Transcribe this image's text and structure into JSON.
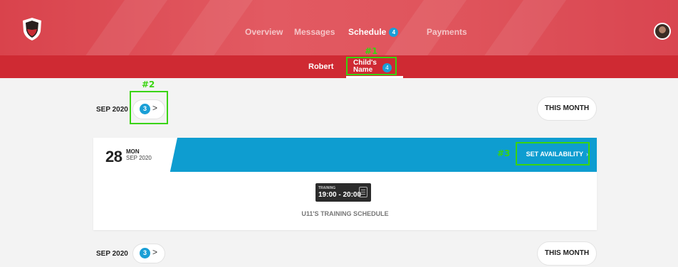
{
  "nav": {
    "items": [
      {
        "label": "Overview"
      },
      {
        "label": "Messages"
      },
      {
        "label": "Schedule",
        "badge": "4"
      },
      {
        "label": "Payments"
      }
    ]
  },
  "subnav": {
    "items": [
      {
        "label": "Robert"
      },
      {
        "label_line1": "Child's",
        "label_line2": "Name",
        "badge": "4"
      }
    ]
  },
  "annotations": [
    "#1",
    "#2",
    "#3"
  ],
  "month_rows": [
    {
      "label": "SEP 2020",
      "badge": "3",
      "chevron": ">",
      "button": "THIS MONTH"
    },
    {
      "label": "SEP 2020",
      "badge": "3",
      "chevron": ">",
      "button": "THIS MONTH"
    }
  ],
  "event_card": {
    "day": "28",
    "weekday": "MON",
    "month_year": "SEP 2020",
    "action": "SET AVAILABILITY",
    "action_chevron": "›",
    "training": {
      "label": "TRAINING",
      "time": "19:00 - 20:00"
    },
    "title": "U11'S TRAINING SCHEDULE"
  },
  "colors": {
    "header": "#d9434c",
    "subbar": "#cf2a33",
    "card_header": "#0e9dd0",
    "badge": "#1a9fd6",
    "annotation": "#39d40f"
  },
  "icons": [
    "shield-logo-icon",
    "avatar",
    "calendar-icon"
  ]
}
